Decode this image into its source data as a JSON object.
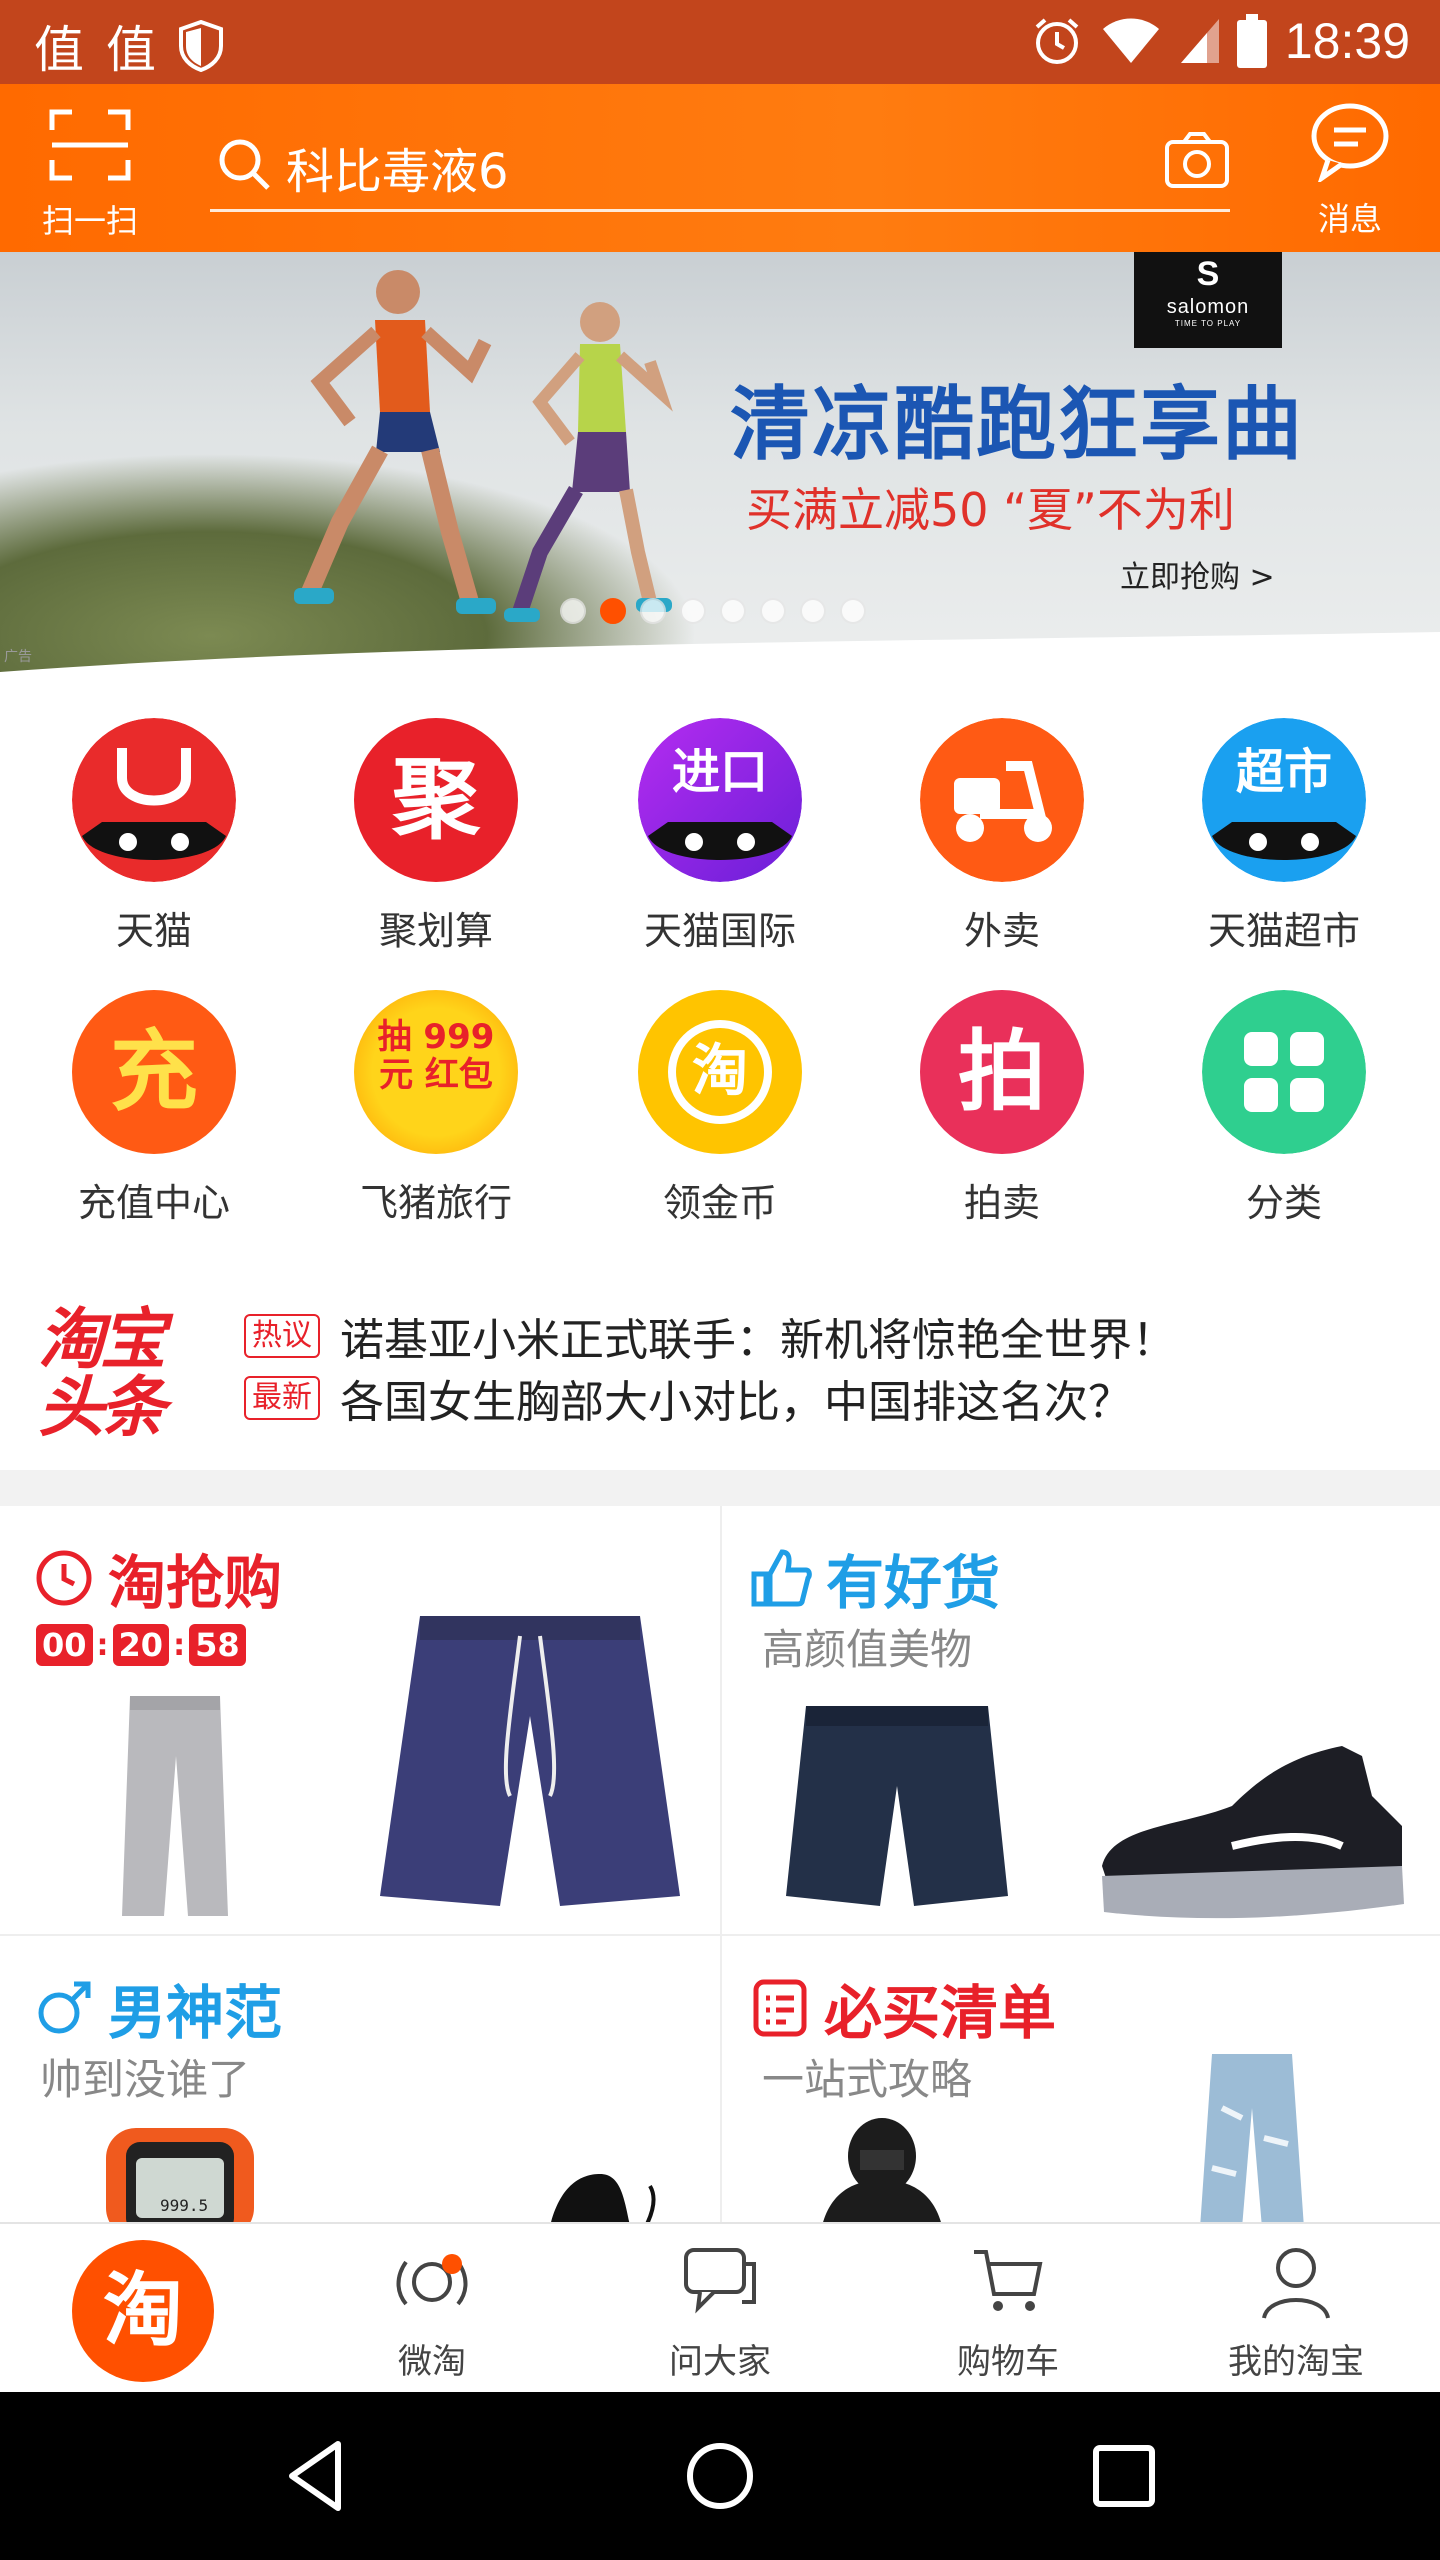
{
  "status_bar": {
    "app_glyphs": [
      "值",
      "值"
    ],
    "time": "18:39"
  },
  "header": {
    "scan_label": "扫一扫",
    "search_placeholder": "科比毒液6",
    "messages_label": "消息"
  },
  "banner": {
    "brand": "salomon",
    "brand_tagline": "TIME TO PLAY",
    "title": "清凉酷跑狂享曲",
    "subtitle": "买满立减50 “夏”不为利",
    "cta": "立即抢购 >",
    "ad_label": "广告",
    "slide_count": 8,
    "active_slide": 2
  },
  "categories": [
    {
      "label": "天猫",
      "icon": "tmall-cat-icon",
      "glyph": "",
      "color": "#e92b2b"
    },
    {
      "label": "聚划算",
      "icon": "juhuasuan-icon",
      "glyph": "聚",
      "color": "#e8212a"
    },
    {
      "label": "天猫国际",
      "icon": "tmall-global-icon",
      "glyph": "进口",
      "color": "#8a2be2"
    },
    {
      "label": "外卖",
      "icon": "scooter-icon",
      "glyph": "",
      "color": "#ff5a14"
    },
    {
      "label": "天猫超市",
      "icon": "tmall-supermarket-icon",
      "glyph": "超市",
      "color": "#1aa0f0"
    },
    {
      "label": "充值中心",
      "icon": "recharge-icon",
      "glyph": "充",
      "color": "#ff5a14"
    },
    {
      "label": "飞猪旅行",
      "icon": "red-envelope-icon",
      "glyph": "抽 999元 红包",
      "color": "#ffcc00"
    },
    {
      "label": "领金币",
      "icon": "gold-coin-icon",
      "glyph": "淘",
      "color": "#ffc400"
    },
    {
      "label": "拍卖",
      "icon": "auction-icon",
      "glyph": "拍",
      "color": "#e9305a"
    },
    {
      "label": "分类",
      "icon": "category-grid-icon",
      "glyph": "",
      "color": "#2fcf8f"
    }
  ],
  "headlines": {
    "logo": "淘宝头条",
    "items": [
      {
        "tag": "热议",
        "text": "诺基亚小米正式联手：新机将惊艳全世界！"
      },
      {
        "tag": "最新",
        "text": "各国女生胸部大小对比，中国排这名次？"
      }
    ]
  },
  "cards": [
    {
      "title": "淘抢购",
      "subtitle": "",
      "icon": "clock-icon",
      "color": "#e8212a",
      "countdown": [
        "00",
        "20",
        "58"
      ]
    },
    {
      "title": "有好货",
      "subtitle": "高颜值美物",
      "icon": "thumbs-up-icon",
      "color": "#1f9ee6"
    },
    {
      "title": "男神范",
      "subtitle": "帅到没谁了",
      "icon": "male-symbol-icon",
      "color": "#1f9ee6"
    },
    {
      "title": "必买清单",
      "subtitle": "一站式攻略",
      "icon": "checklist-icon",
      "color": "#e8212a"
    }
  ],
  "watch_readout": "999.5",
  "tabbar": {
    "home_glyph": "淘",
    "items": [
      {
        "label": "微淘",
        "icon": "weitao-icon"
      },
      {
        "label": "问大家",
        "icon": "chat-bubbles-icon"
      },
      {
        "label": "购物车",
        "icon": "cart-icon"
      },
      {
        "label": "我的淘宝",
        "icon": "person-icon"
      }
    ]
  }
}
